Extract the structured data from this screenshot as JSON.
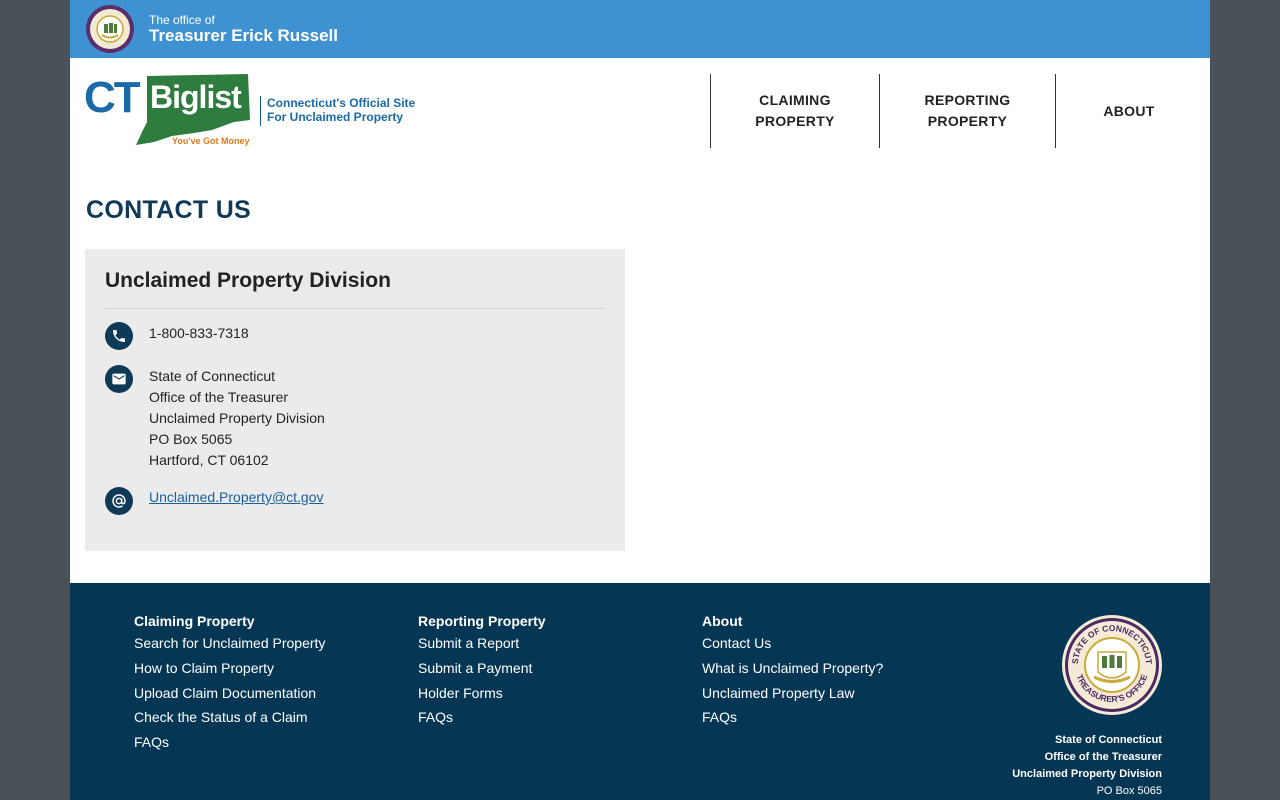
{
  "topbar": {
    "office_prefix": "The office of",
    "office_name": "Treasurer Erick Russell"
  },
  "header": {
    "logo_ct": "CT",
    "logo_biglist": "Biglist",
    "logo_slogan": "You've Got Money",
    "tagline_line1": "Connecticut's Official Site",
    "tagline_line2": "For Unclaimed Property"
  },
  "nav": {
    "claiming_line1": "CLAIMING",
    "claiming_line2": "PROPERTY",
    "reporting_line1": "REPORTING",
    "reporting_line2": "PROPERTY",
    "about": "ABOUT"
  },
  "main": {
    "title": "CONTACT US",
    "card": {
      "title": "Unclaimed Property Division",
      "phone": "1-800-833-7318",
      "address": [
        "State of Connecticut",
        "Office of the Treasurer",
        "Unclaimed Property Division",
        "PO Box 5065",
        "Hartford, CT 06102"
      ],
      "email": "Unclaimed.Property@ct.gov"
    }
  },
  "footer": {
    "claiming": {
      "heading": "Claiming Property",
      "links": [
        "Search for Unclaimed Property",
        "How to Claim Property",
        "Upload Claim Documentation",
        "Check the Status of a Claim",
        "FAQs"
      ]
    },
    "reporting": {
      "heading": "Reporting Property",
      "links": [
        "Submit a Report",
        "Submit a Payment",
        "Holder Forms",
        "FAQs"
      ]
    },
    "about": {
      "heading": "About",
      "links": [
        "Contact Us",
        "What is Unclaimed Property?",
        "Unclaimed Property Law",
        "FAQs"
      ]
    },
    "seal_text_top": "STATE OF CONNECTICUT",
    "seal_text_bottom": "TREASURER'S OFFICE",
    "address": {
      "line1": "State of Connecticut",
      "line2": "Office of the Treasurer",
      "line3": "Unclaimed Property Division",
      "line4": "PO Box 5065"
    }
  },
  "colors": {
    "topbar": "#3f92d2",
    "navy": "#0f3a57",
    "footer": "#053654",
    "logo_green": "#2e7d3e",
    "logo_blue": "#1a6aa8",
    "logo_orange": "#e07a1f"
  }
}
